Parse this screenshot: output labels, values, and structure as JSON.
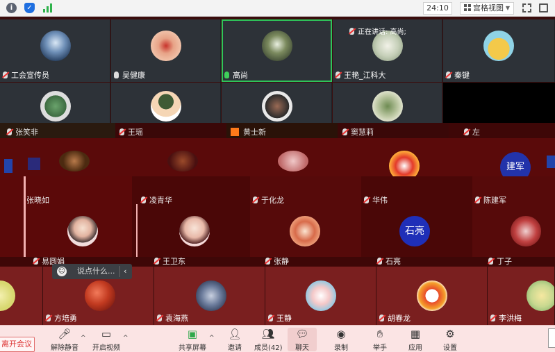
{
  "topbar": {
    "timer": "24:10",
    "view_mode": "宫格视图",
    "icons": [
      "info-icon",
      "shield-icon",
      "signal-icon",
      "fullscreen-icon",
      "exit-fullscreen-icon"
    ]
  },
  "speaking": {
    "label": "正在讲话: 高尚;"
  },
  "row1": [
    {
      "name": "工会宣传员",
      "mic": "off"
    },
    {
      "name": "吴健康",
      "mic": "on"
    },
    {
      "name": "高尚",
      "mic": "on"
    },
    {
      "name": "王艳_江科大",
      "mic": "off"
    },
    {
      "name": "秦键",
      "mic": "off"
    }
  ],
  "row3_labels": [
    "张笑非",
    "王瑶",
    "黄士新",
    "窦慧莉",
    "左"
  ],
  "row4": [
    {
      "name": "张晓如"
    },
    {
      "name": "凌青华"
    },
    {
      "name": "于化龙"
    },
    {
      "name": "华伟"
    },
    {
      "name": "陈建军"
    }
  ],
  "row4_avatar_text": {
    "shi_liang": "石亮",
    "jian_jun": "建军"
  },
  "row5_labels": [
    "王卫东",
    "张静",
    "石亮",
    "丁子"
  ],
  "row6_labels": [
    "方培勇",
    "袁海燕",
    "王静",
    "胡春龙",
    "李洪梅"
  ],
  "chat": {
    "placeholder": "说点什么..."
  },
  "toolbar": {
    "leave": "离开会议",
    "unmute": "解除静音",
    "start_video": "开启视频",
    "share_screen": "共享屏幕",
    "invite": "邀请",
    "members": "成员(42)",
    "chat": "聊天",
    "record": "录制",
    "raise_hand": "举手",
    "apps": "应用",
    "settings": "设置"
  },
  "colors": {
    "active_border": "#2ec45a",
    "toolbar_bg": "#fbe4e4",
    "tile_dark": "#2d3238",
    "tile_maroon": "#5a0a0a"
  }
}
